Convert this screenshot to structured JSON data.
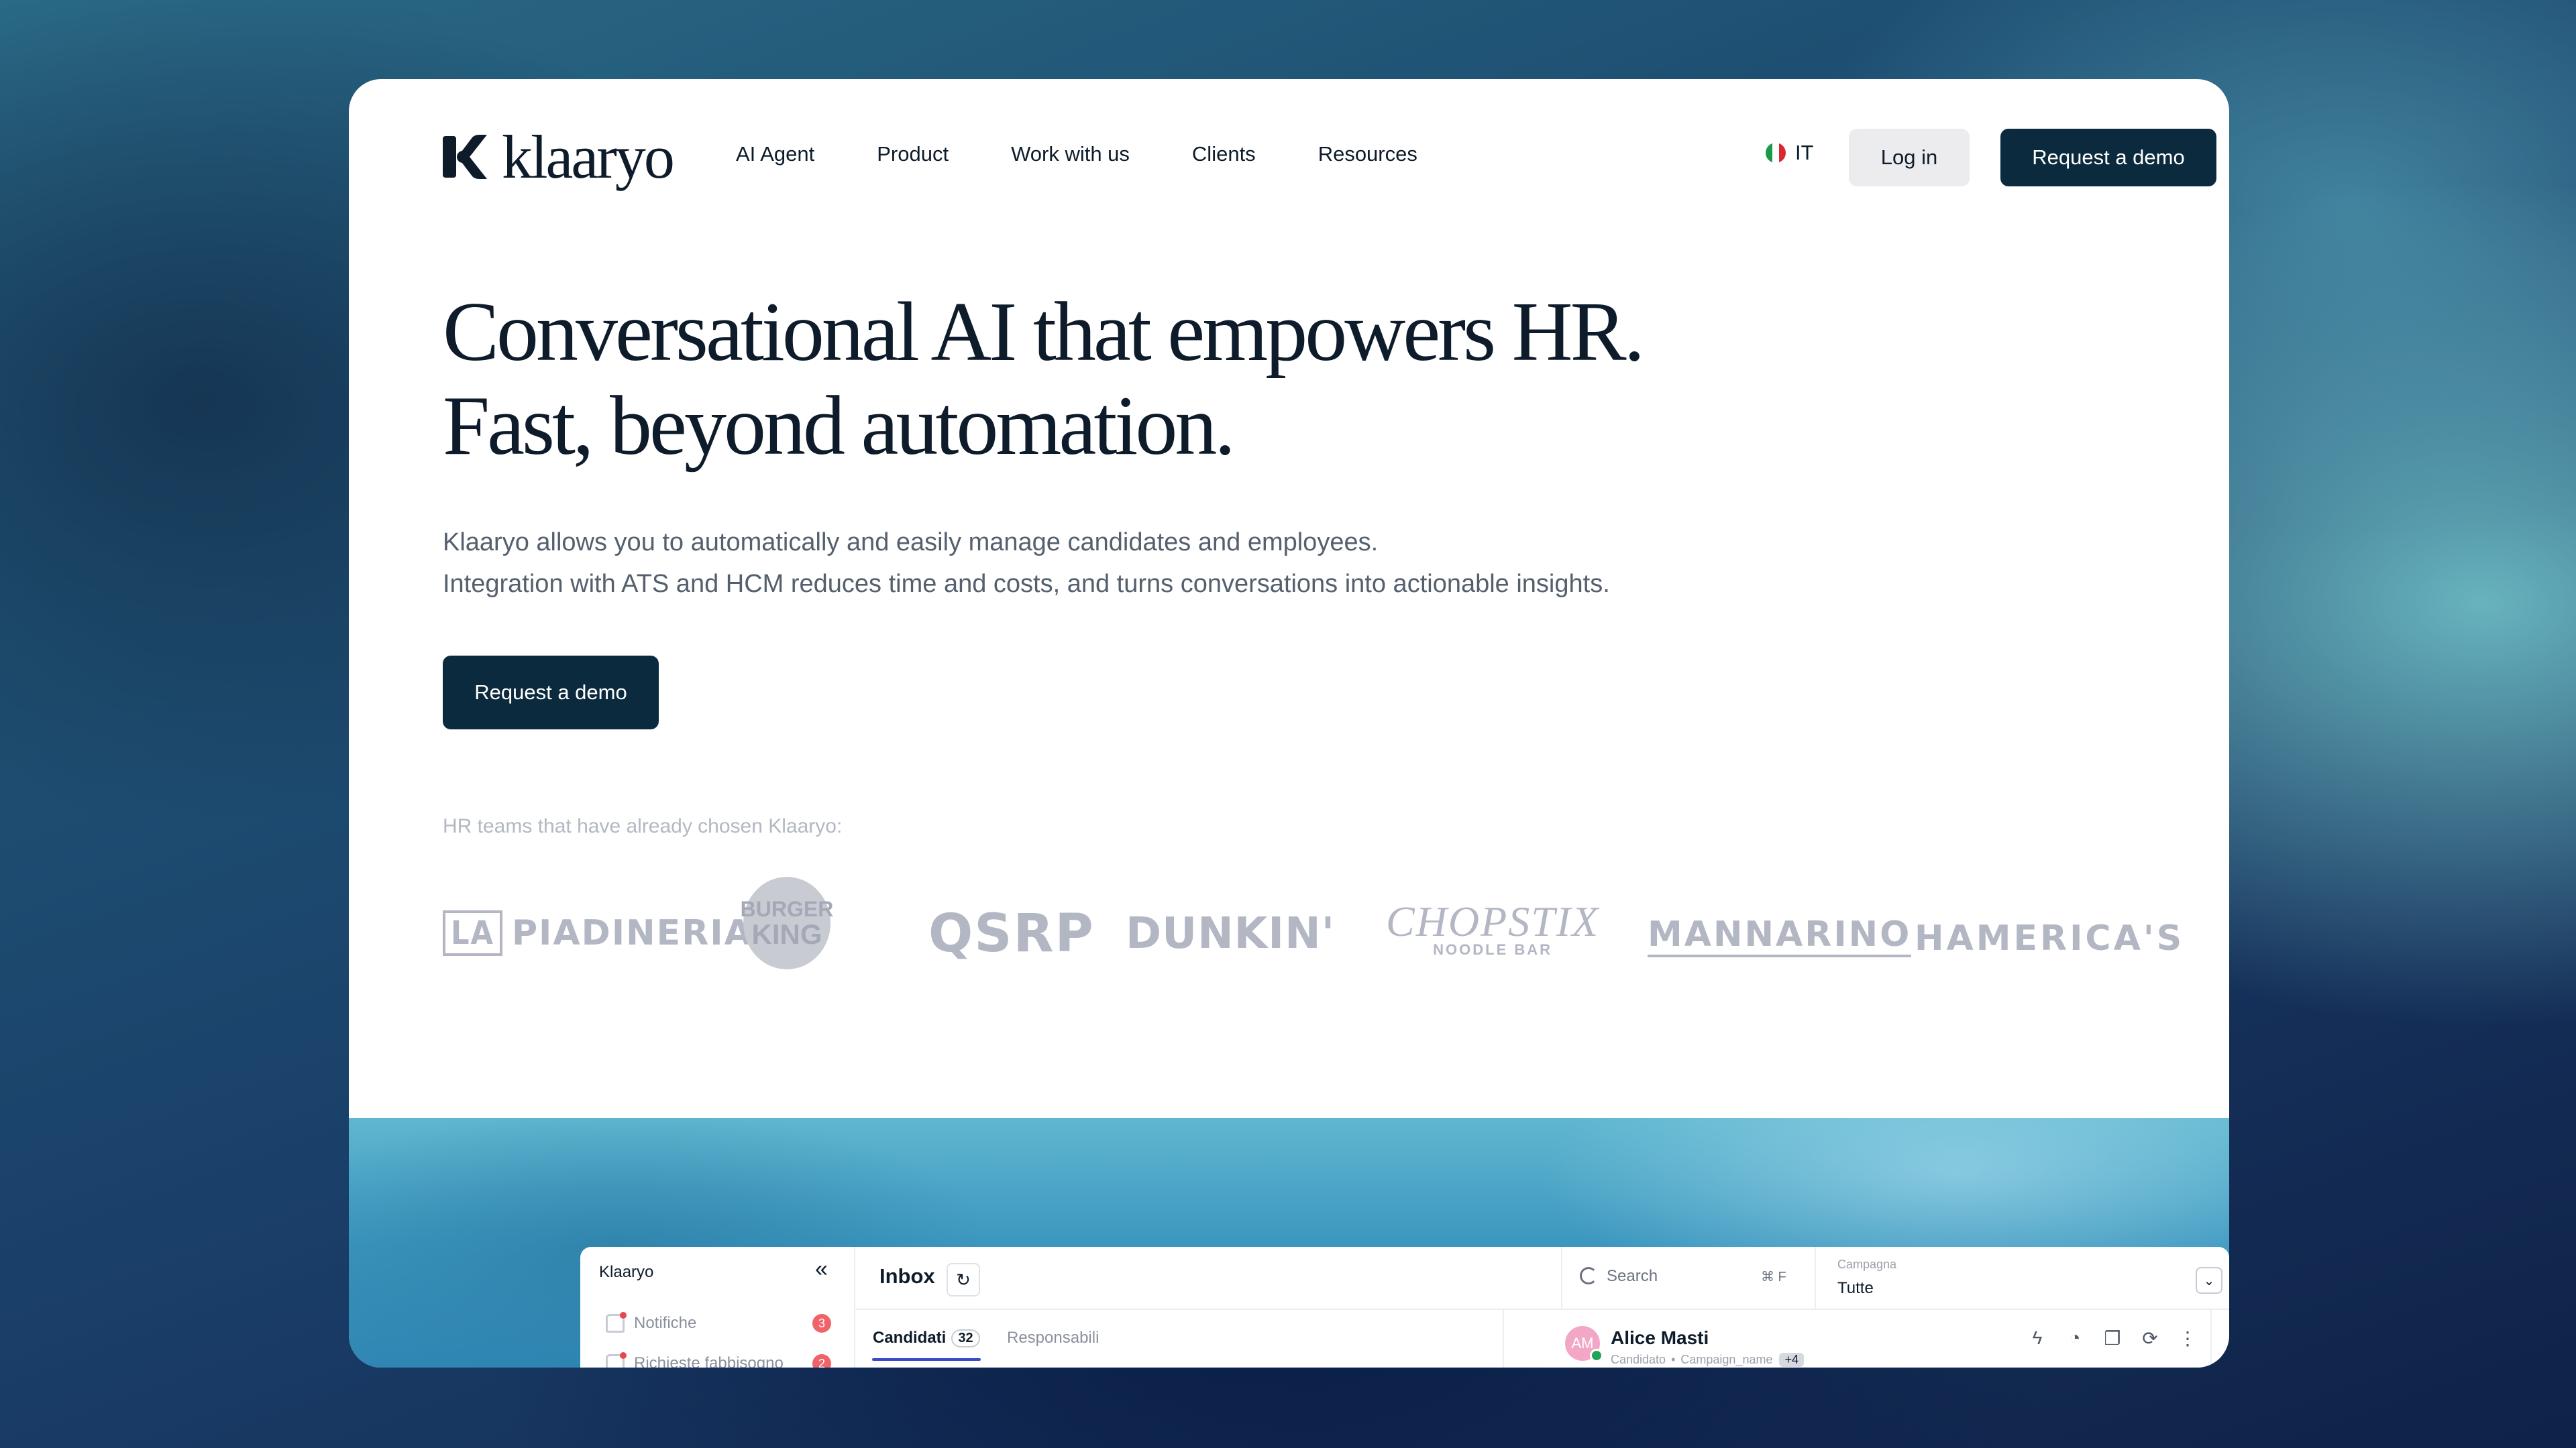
{
  "brand": {
    "name": "klaaryo"
  },
  "nav": {
    "links": [
      "AI Agent",
      "Product",
      "Work with us",
      "Clients",
      "Resources"
    ],
    "language": "IT",
    "login_label": "Log in",
    "demo_label": "Request a demo"
  },
  "hero": {
    "title_line1": "Conversational AI that empowers HR.",
    "title_line2": "Fast, beyond automation.",
    "subtitle_line1": "Klaaryo allows you to automatically and easily manage candidates and employees.",
    "subtitle_line2": "Integration with ATS and HCM reduces time and costs, and turns conversations into actionable insights.",
    "cta_label": "Request a demo"
  },
  "clients": {
    "label": "HR teams that have already chosen Klaaryo:",
    "logos": [
      {
        "name": "la-piadineria",
        "text_a": "LA",
        "text_b": "PIADINERIA"
      },
      {
        "name": "burger-king",
        "text_a": "BURGER",
        "text_b": "KING"
      },
      {
        "name": "qsrp",
        "text": "QSRP"
      },
      {
        "name": "dunkin",
        "text": "DUNKIN'"
      },
      {
        "name": "chopstix",
        "text_a": "CHOPSTIX",
        "text_b": "NOODLE BAR"
      },
      {
        "name": "mannarino",
        "text": "MANNARINO"
      },
      {
        "name": "hamericas",
        "text": "HAMERICA'S"
      }
    ]
  },
  "app_preview": {
    "sidebar_title": "Klaaryo",
    "sidebar_items": [
      {
        "label": "Notifiche",
        "count": "3"
      },
      {
        "label": "Richieste fabbisogno",
        "count": "2"
      }
    ],
    "inbox_title": "Inbox",
    "search_placeholder": "Search",
    "search_shortcut": "⌘ F",
    "campaign_label": "Campagna",
    "campaign_value": "Tutte",
    "tabs": [
      {
        "label": "Candidati",
        "count": "32"
      },
      {
        "label": "Responsabili"
      }
    ],
    "candidate": {
      "initials": "AM",
      "name": "Alice Masti",
      "role": "Candidato",
      "campaign": "Campaign_name",
      "extra": "+4"
    }
  },
  "colors": {
    "primary_dark": "#0c2a3e",
    "text_dark": "#0d1b2a",
    "muted": "#55606e",
    "logo_gray": "#b3b6c3",
    "accent_tab": "#3b4cca"
  }
}
